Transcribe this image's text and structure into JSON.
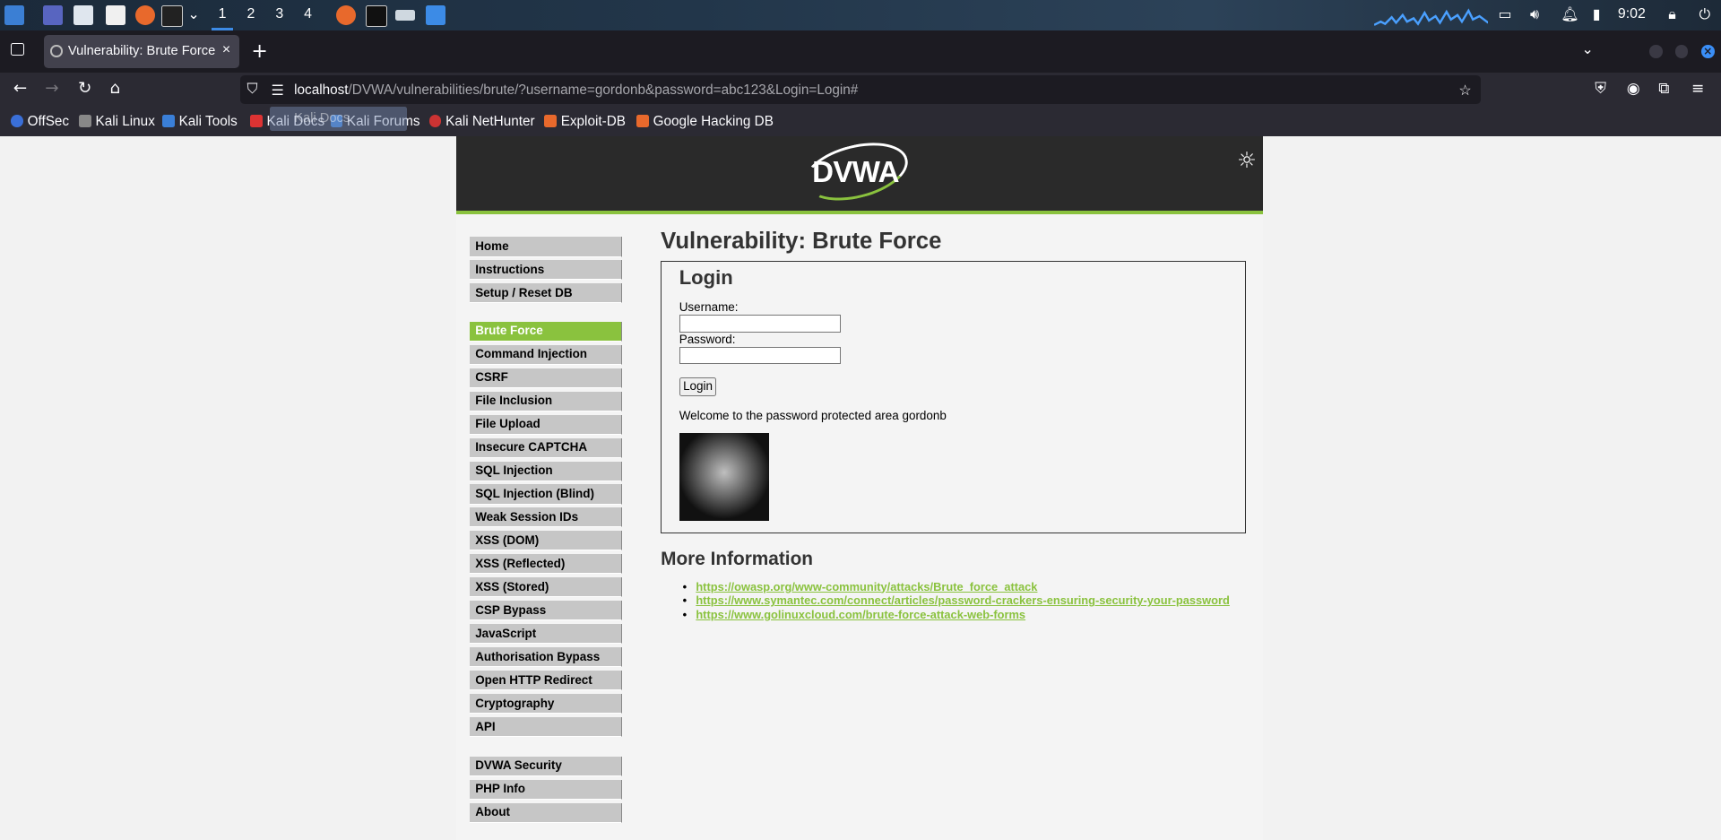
{
  "taskbar": {
    "workspaces": [
      "1",
      "2",
      "3",
      "4"
    ],
    "clock": "9:02"
  },
  "browser": {
    "tab_title": "Vulnerability: Brute Force",
    "tab_close": "×",
    "new_tab": "+",
    "url_host": "localhost",
    "url_path": "/DVWA/vulnerabilities/brute/?username=gordonb&password=abc123&Login=Login#",
    "bookmarks": [
      "OffSec",
      "Kali Linux",
      "Kali Tools",
      "Kali Docs",
      "Kali Forums",
      "Kali NetHunter",
      "Exploit-DB",
      "Google Hacking DB"
    ],
    "bookmark_overlay": "Kali Docs"
  },
  "dvwa": {
    "logo": "DVWA",
    "menu_top": [
      "Home",
      "Instructions",
      "Setup / Reset DB"
    ],
    "menu_vulns": [
      "Brute Force",
      "Command Injection",
      "CSRF",
      "File Inclusion",
      "File Upload",
      "Insecure CAPTCHA",
      "SQL Injection",
      "SQL Injection (Blind)",
      "Weak Session IDs",
      "XSS (DOM)",
      "XSS (Reflected)",
      "XSS (Stored)",
      "CSP Bypass",
      "JavaScript",
      "Authorisation Bypass",
      "Open HTTP Redirect",
      "Cryptography",
      "API"
    ],
    "menu_bottom": [
      "DVWA Security",
      "PHP Info",
      "About"
    ],
    "selected": "Brute Force",
    "page_title": "Vulnerability: Brute Force",
    "login": {
      "heading": "Login",
      "username_label": "Username:",
      "password_label": "Password:",
      "username_value": "",
      "password_value": "",
      "button": "Login",
      "welcome": "Welcome to the password protected area gordonb"
    },
    "more_info_title": "More Information",
    "links": [
      "https://owasp.org/www-community/attacks/Brute_force_attack",
      "https://www.symantec.com/connect/articles/password-crackers-ensuring-security-your-password",
      "https://www.golinuxcloud.com/brute-force-attack-web-forms"
    ]
  },
  "colors": {
    "accent_green": "#8ac23e",
    "header_dark": "#2a2a2a",
    "menu_grey": "#c6c6c6",
    "browser_dark": "#2b2a33"
  }
}
